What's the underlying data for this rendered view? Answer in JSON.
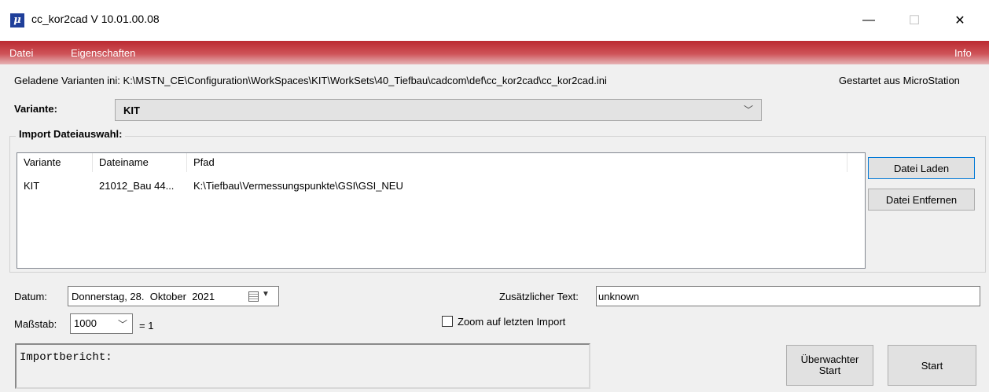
{
  "window": {
    "title": "cc_kor2cad V 10.01.00.08",
    "icon": "microstation-mu-icon",
    "minimize": "—",
    "maximize": "☐",
    "close": "✕"
  },
  "menu": {
    "items": [
      "Datei",
      "Eigenschaften"
    ],
    "right_item": "Info",
    "gradient_top": "#bb2a31"
  },
  "info": {
    "ini_path": "Geladene Varianten ini: K:\\MSTN_CE\\Configuration\\WorkSpaces\\KIT\\WorkSets\\40_Tiefbau\\cadcom\\def\\cc_kor2cad\\cc_kor2cad.ini",
    "started_from": "Gestartet aus MicroStation"
  },
  "variant": {
    "label": "Variante:",
    "selected": "KIT"
  },
  "import": {
    "group_title": "Import Dateiauswahl:",
    "columns": [
      "Variante",
      "Dateiname",
      "Pfad"
    ],
    "rows": [
      [
        "KIT",
        "21012_Bau 44...",
        "K:\\Tiefbau\\Vermessungspunkte\\GSI\\GSI_NEU"
      ]
    ],
    "load_button": "Datei Laden",
    "remove_button": "Datei Entfernen"
  },
  "date": {
    "label": "Datum:",
    "value": "Donnerstag, 28.  Oktober  2021"
  },
  "scale": {
    "label": "Maßstab:",
    "value": "1000",
    "suffix": "= 1"
  },
  "extra_text": {
    "label": "Zusätzlicher Text:",
    "value": "unknown"
  },
  "zoom": {
    "label": "Zoom auf letzten Import",
    "checked": false
  },
  "report": {
    "text": "Importbericht:"
  },
  "actions": {
    "watched_start_line1": "Überwachter",
    "watched_start_line2": "Start",
    "start": "Start"
  }
}
